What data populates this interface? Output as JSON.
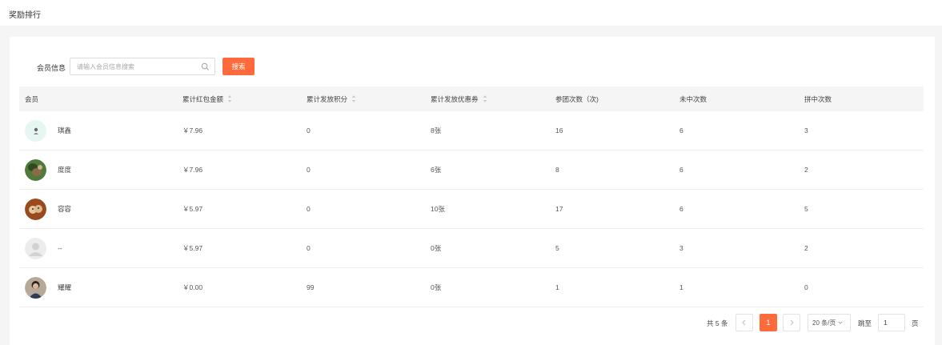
{
  "page": {
    "title": "奖励排行"
  },
  "search": {
    "label": "会员信息",
    "placeholder": "请输入会员信息搜索",
    "value": "",
    "button_label": "搜索",
    "icon": "search-icon"
  },
  "table": {
    "columns": [
      {
        "label": "会员",
        "sortable": false
      },
      {
        "label": "累计红包金额",
        "sortable": true
      },
      {
        "label": "累计发放积分",
        "sortable": true
      },
      {
        "label": "累计发放优惠券",
        "sortable": true
      },
      {
        "label": "参团次数（次)",
        "sortable": false
      },
      {
        "label": "未中次数",
        "sortable": false
      },
      {
        "label": "拼中次数",
        "sortable": false
      }
    ],
    "rows": [
      {
        "name": "琪鑫",
        "avatar": "avatar-light",
        "amount": "￥7.96",
        "points": "0",
        "coupons": "8张",
        "joins": "16",
        "misses": "6",
        "wins": "3"
      },
      {
        "name": "度度",
        "avatar": "avatar-green",
        "amount": "￥7.96",
        "points": "0",
        "coupons": "6张",
        "joins": "8",
        "misses": "6",
        "wins": "2"
      },
      {
        "name": "容容",
        "avatar": "avatar-brown",
        "amount": "￥5.97",
        "points": "0",
        "coupons": "10张",
        "joins": "17",
        "misses": "6",
        "wins": "5"
      },
      {
        "name": "--",
        "avatar": "avatar-default",
        "amount": "￥5.97",
        "points": "0",
        "coupons": "0张",
        "joins": "5",
        "misses": "3",
        "wins": "2"
      },
      {
        "name": "耀耀",
        "avatar": "avatar-person",
        "amount": "￥0.00",
        "points": "99",
        "coupons": "0张",
        "joins": "1",
        "misses": "1",
        "wins": "0"
      }
    ]
  },
  "pagination": {
    "total_text": "共 5 条",
    "current_page": "1",
    "prev_icon": "chevron-left-icon",
    "next_icon": "chevron-right-icon",
    "page_size": "20 条/页",
    "goto_label": "跳至",
    "goto_value": "1",
    "page_suffix": "页"
  },
  "colors": {
    "accent": "#ff6a3d",
    "header_bg": "#f5f5f5",
    "page_bg": "#f5f5f5"
  }
}
